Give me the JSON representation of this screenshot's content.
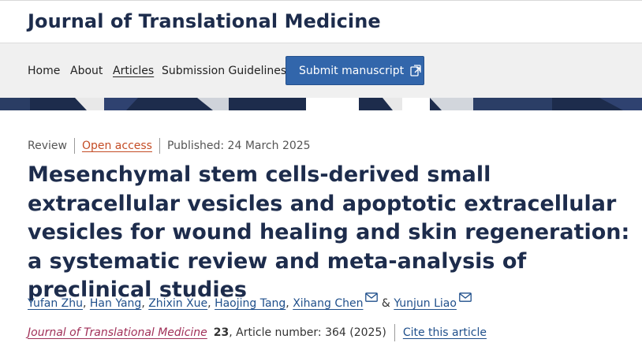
{
  "site": {
    "journal_title": "Journal of Translational Medicine"
  },
  "nav": {
    "items": [
      {
        "label": "Home"
      },
      {
        "label": "About"
      },
      {
        "label": "Articles"
      },
      {
        "label": "Submission Guidelines"
      }
    ],
    "submit_label": "Submit manuscript",
    "submit_icon": "external-link-icon",
    "active_item": "Articles"
  },
  "article": {
    "type": "Review",
    "access": "Open access",
    "published": "Published: 24 March 2025",
    "title": "Mesenchymal stem cells-derived small extracellular vesicles and apoptotic extracellular vesicles for wound healing and skin regeneration: a systematic review and meta-analysis of preclinical studies",
    "authors": [
      {
        "name": "Yufan Zhu",
        "sep": ", "
      },
      {
        "name": "Han Yang",
        "sep": ", "
      },
      {
        "name": "Zhixin Xue",
        "sep": ", "
      },
      {
        "name": "Haojing Tang",
        "sep": ", "
      },
      {
        "name": "Xihang Chen",
        "sep": " & "
      },
      {
        "name": "Yunjun Liao",
        "sep": ""
      }
    ],
    "citation": {
      "journal": "Journal of Translational Medicine",
      "volume": "23",
      "article_number": ", Article number: 364 (2025)",
      "cite_label": "Cite this article"
    }
  },
  "colors": {
    "brand_navy": "#1d2c4c",
    "button_blue": "#3266ab",
    "open_access_orange": "#c44d26",
    "journal_link": "#a03058",
    "link_blue": "#1f4f8b"
  }
}
